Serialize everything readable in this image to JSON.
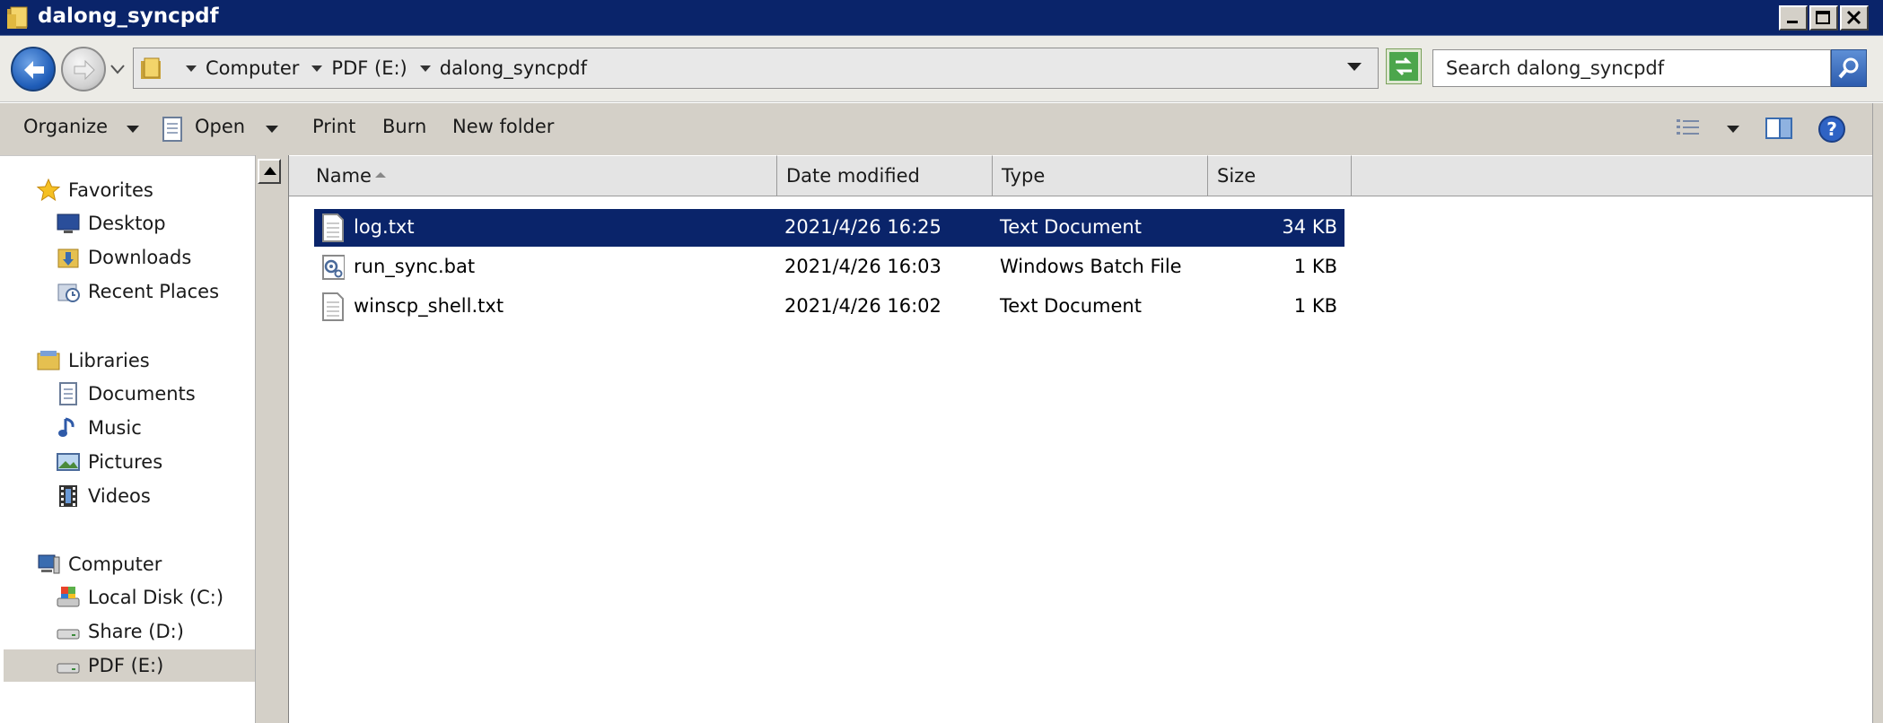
{
  "window": {
    "title": "dalong_syncpdf"
  },
  "address": {
    "breadcrumbs": [
      "Computer",
      "PDF (E:)",
      "dalong_syncpdf"
    ]
  },
  "search": {
    "placeholder": "Search dalong_syncpdf"
  },
  "toolbar": {
    "organize": "Organize",
    "open": "Open",
    "print": "Print",
    "burn": "Burn",
    "new_folder": "New folder"
  },
  "nav": {
    "favorites": {
      "label": "Favorites",
      "items": [
        "Desktop",
        "Downloads",
        "Recent Places"
      ]
    },
    "libraries": {
      "label": "Libraries",
      "items": [
        "Documents",
        "Music",
        "Pictures",
        "Videos"
      ]
    },
    "computer": {
      "label": "Computer",
      "items": [
        "Local Disk (C:)",
        "Share (D:)",
        "PDF (E:)"
      ]
    },
    "selected": "PDF (E:)"
  },
  "columns": [
    "Name",
    "Date modified",
    "Type",
    "Size"
  ],
  "files": [
    {
      "name": "log.txt",
      "date": "2021/4/26 16:25",
      "type": "Text Document",
      "size": "34 KB",
      "icon": "text-file-icon",
      "selected": true
    },
    {
      "name": "run_sync.bat",
      "date": "2021/4/26 16:03",
      "type": "Windows Batch File",
      "size": "1 KB",
      "icon": "batch-file-icon",
      "selected": false
    },
    {
      "name": "winscp_shell.txt",
      "date": "2021/4/26 16:02",
      "type": "Text Document",
      "size": "1 KB",
      "icon": "text-file-icon",
      "selected": false
    }
  ],
  "colors": {
    "titlebar": "#0a246a",
    "selection": "#0a246a",
    "chrome": "#d4d0c8"
  }
}
